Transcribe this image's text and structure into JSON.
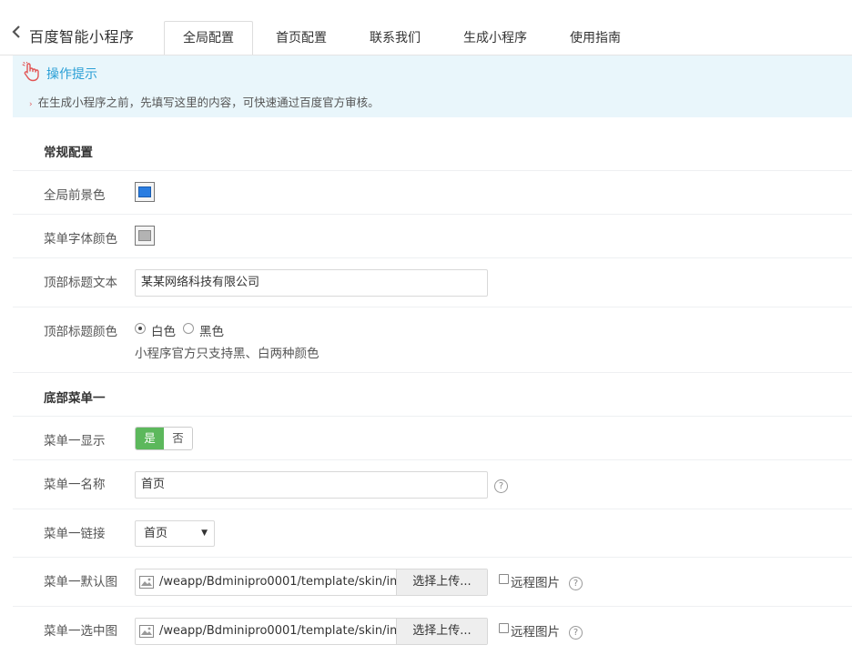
{
  "app": {
    "title": "百度智能小程序"
  },
  "tabs": [
    {
      "label": "全局配置",
      "active": true
    },
    {
      "label": "首页配置",
      "active": false
    },
    {
      "label": "联系我们",
      "active": false
    },
    {
      "label": "生成小程序",
      "active": false
    },
    {
      "label": "使用指南",
      "active": false
    }
  ],
  "tip": {
    "title": "操作提示",
    "text": "在生成小程序之前，先填写这里的内容，可快速通过百度官方审核。"
  },
  "general": {
    "section_title": "常规配置",
    "foreground_label": "全局前景色",
    "foreground_color": "#2a7de1",
    "menu_font_color_label": "菜单字体颜色",
    "menu_font_color": "#b3b3b3",
    "top_title_text_label": "顶部标题文本",
    "top_title_text_value": "某某网络科技有限公司",
    "top_title_color_label": "顶部标题颜色",
    "top_title_color_options": [
      {
        "label": "白色",
        "checked": true
      },
      {
        "label": "黑色",
        "checked": false
      }
    ],
    "top_title_color_hint": "小程序官方只支持黑、白两种颜色"
  },
  "menu1": {
    "section_title": "底部菜单一",
    "display_label": "菜单一显示",
    "display_yes": "是",
    "display_no": "否",
    "display_value": "是",
    "name_label": "菜单一名称",
    "name_value": "首页",
    "link_label": "菜单一链接",
    "link_value": "首页",
    "default_img_label": "菜单一默认图",
    "default_img_path": "/weapp/Bdminipro0001/template/skin/im",
    "selected_img_label": "菜单一选中图",
    "selected_img_path": "/weapp/Bdminipro0001/template/skin/im",
    "upload_button": "选择上传...",
    "remote_label": "远程图片",
    "help_glyph": "?"
  },
  "icons": {
    "back": "chevron-left-icon",
    "tip": "pointing-hand-icon",
    "image": "image-icon",
    "help": "question-circle-icon"
  },
  "colors": {
    "accent": "#2a9fd6",
    "tip_bg": "#e9f6fb",
    "toggle_on": "#5cb85c"
  }
}
